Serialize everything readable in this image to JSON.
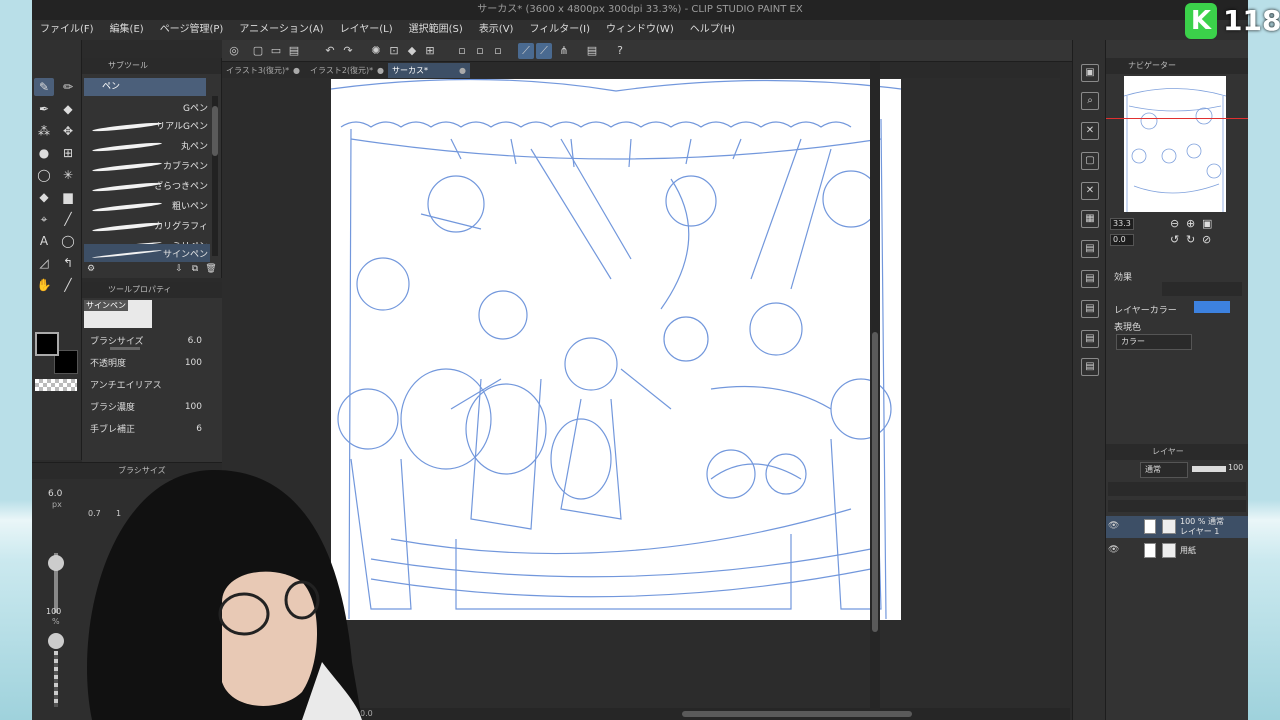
{
  "window": {
    "title": "サーカス* (3600 x 4800px 300dpi 33.3%)  - CLIP STUDIO PAINT EX"
  },
  "menu": [
    "ファイル(F)",
    "編集(E)",
    "ページ管理(P)",
    "アニメーション(A)",
    "レイヤー(L)",
    "選択範囲(S)",
    "表示(V)",
    "フィルター(I)",
    "ウィンドウ(W)",
    "ヘルプ(H)"
  ],
  "tabs": [
    {
      "label": "イラスト3(復元)*",
      "active": false
    },
    {
      "label": "イラスト2(復元)*",
      "active": false
    },
    {
      "label": "サーカス*",
      "active": true
    }
  ],
  "subtool": {
    "header": "サブツール",
    "current": "ペン",
    "brushes": [
      "Gペン",
      "リアルGペン",
      "丸ペン",
      "カブラペン",
      "ざらつきペン",
      "粗いペン",
      "カリグラフィ",
      "ミリペン",
      "サインペン"
    ]
  },
  "tool_property": {
    "header": "ツールプロパティ",
    "preset_name": "サインペン",
    "rows": [
      {
        "label": "ブラシサイズ",
        "value": "6.0"
      },
      {
        "label": "不透明度",
        "value": "100"
      },
      {
        "label": "アンチエイリアス",
        "value": ""
      },
      {
        "label": "ブラシ濃度",
        "value": "100"
      },
      {
        "label": "手ブレ補正",
        "value": "6"
      }
    ]
  },
  "brush_size_panel": {
    "header": "ブラシサイズ",
    "size_value": "6.0",
    "size_unit": "px",
    "preset_a": "0.7",
    "preset_b": "1",
    "opacity_value": "100",
    "opacity_unit": "%"
  },
  "navigator": {
    "header": "ナビゲーター",
    "zoom": "33.3",
    "rotation": "0.0"
  },
  "effect_panel": {
    "section_effect": "効果",
    "layer_color_label": "レイヤーカラー",
    "layer_color": "#3d82e0",
    "display_color_label": "表現色",
    "display_color_value": "カラー"
  },
  "layer_panel": {
    "header": "レイヤー",
    "blend_mode": "通常",
    "opacity": "100",
    "layers": [
      {
        "line1": "100 % 通常",
        "line2": "レイヤー 1",
        "selected": true
      },
      {
        "line1": "用紙",
        "line2": "",
        "selected": false
      }
    ]
  },
  "canvas_status": {
    "zoom": "0.0"
  },
  "overlay": {
    "badge_letter": "K",
    "badge_number": "118",
    "badge_color": "#3bd14a"
  }
}
